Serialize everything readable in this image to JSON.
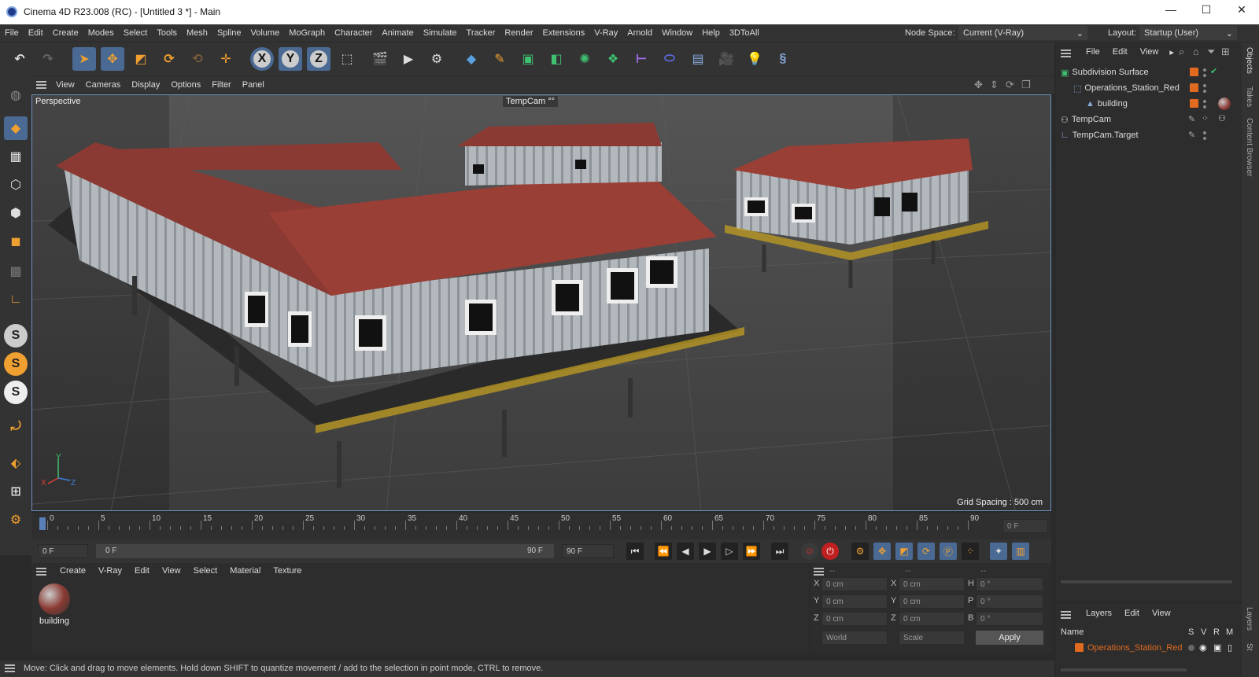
{
  "window": {
    "title": "Cinema 4D R23.008 (RC) - [Untitled 3 *] - Main",
    "controls": [
      "—",
      "☐",
      "✕"
    ]
  },
  "menubar": {
    "items": [
      "File",
      "Edit",
      "Create",
      "Modes",
      "Select",
      "Tools",
      "Mesh",
      "Spline",
      "Volume",
      "MoGraph",
      "Character",
      "Animate",
      "Simulate",
      "Tracker",
      "Render",
      "Extensions",
      "V-Ray",
      "Arnold",
      "Window",
      "Help",
      "3DToAll"
    ],
    "node_space_label": "Node Space:",
    "node_space_value": "Current (V-Ray)",
    "layout_label": "Layout:",
    "layout_value": "Startup (User)"
  },
  "toolbar": {
    "axis_x": "X",
    "axis_y": "Y",
    "axis_z": "Z"
  },
  "viewport": {
    "menu": [
      "View",
      "Cameras",
      "Display",
      "Options",
      "Filter",
      "Panel"
    ],
    "label": "Perspective",
    "camera": "TempCam",
    "grid_spacing": "Grid Spacing : 500 cm",
    "axis_labels": {
      "y": "Y",
      "x": "X",
      "z": "Z"
    }
  },
  "timeline": {
    "ticks": [
      "0",
      "5",
      "10",
      "15",
      "20",
      "25",
      "30",
      "35",
      "40",
      "45",
      "50",
      "55",
      "60",
      "65",
      "70",
      "75",
      "80",
      "85",
      "90"
    ],
    "current_frame": "0 F",
    "start_frame": "0 F",
    "range_start": "0 F",
    "range_end": "90 F",
    "end_frame": "90 F"
  },
  "material_panel": {
    "menu": [
      "Create",
      "V-Ray",
      "Edit",
      "View",
      "Select",
      "Material",
      "Texture"
    ],
    "material_name": "building"
  },
  "coord_panel": {
    "headers": [
      "--",
      "--",
      "--"
    ],
    "rows": [
      {
        "a": "X",
        "av": "0 cm",
        "b": "X",
        "bv": "0 cm",
        "c": "H",
        "cv": "0 °"
      },
      {
        "a": "Y",
        "av": "0 cm",
        "b": "Y",
        "bv": "0 cm",
        "c": "P",
        "cv": "0 °"
      },
      {
        "a": "Z",
        "av": "0 cm",
        "b": "Z",
        "bv": "0 cm",
        "c": "B",
        "cv": "0 °"
      }
    ],
    "world": "World",
    "scale": "Scale",
    "apply": "Apply"
  },
  "status": "Move: Click and drag to move elements. Hold down SHIFT to quantize movement / add to the selection in point mode, CTRL to remove.",
  "object_manager": {
    "menu": [
      "File",
      "Edit",
      "View"
    ],
    "objects": [
      {
        "name": "Subdivision Surface",
        "indent": 0
      },
      {
        "name": "Operations_Station_Red",
        "indent": 1
      },
      {
        "name": "building",
        "indent": 2
      },
      {
        "name": "TempCam",
        "indent": 0
      },
      {
        "name": "TempCam.Target",
        "indent": 0
      }
    ]
  },
  "layer_manager": {
    "menu": [
      "Layers",
      "Edit",
      "View"
    ],
    "col_name": "Name",
    "cols": [
      "S",
      "V",
      "R",
      "M"
    ],
    "layer": "Operations_Station_Red"
  },
  "right_tabs": [
    "Objects",
    "Takes",
    "Content Browser",
    "Layers",
    "St"
  ],
  "colors": {
    "accent": "#e06a20",
    "selection": "#4a6a93",
    "roof": "#8a3a32",
    "wall": "#a9afb4"
  }
}
